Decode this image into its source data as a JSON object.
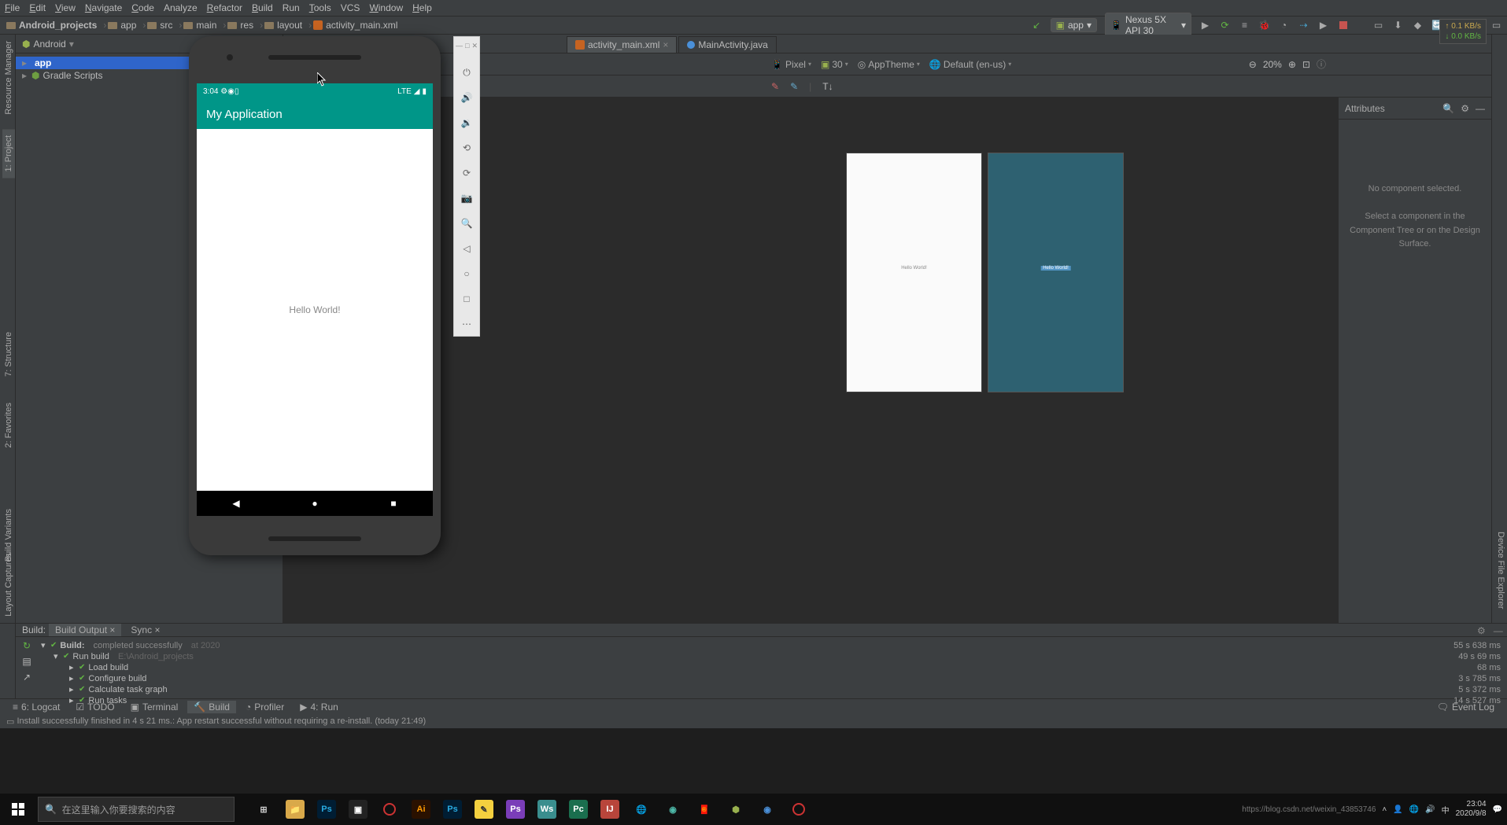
{
  "menu": {
    "file": "File",
    "edit": "Edit",
    "view": "View",
    "navigate": "Navigate",
    "code": "Code",
    "analyze": "Analyze",
    "refactor": "Refactor",
    "build": "Build",
    "run": "Run",
    "tools": "Tools",
    "vcs": "VCS",
    "window": "Window",
    "help": "Help"
  },
  "breadcrumb": {
    "root": "Android_projects",
    "app": "app",
    "src": "src",
    "main": "main",
    "res": "res",
    "layout": "layout",
    "file": "activity_main.xml"
  },
  "run_config": {
    "module": "app",
    "device": "Nexus 5X API 30"
  },
  "net": {
    "up": "↑ 0.1 KB/s",
    "down": "↓ 0.0 KB/s"
  },
  "project": {
    "view": "Android",
    "root": "app",
    "gradle": "Gradle Scripts"
  },
  "tabs": {
    "t1": "activity_main.xml",
    "t2": "MainActivity.java"
  },
  "design": {
    "device": "Pixel",
    "api": "30",
    "theme": "AppTheme",
    "locale": "Default (en-us)",
    "zoom": "20%",
    "attr_title": "Attributes",
    "attr_msg1": "No component selected.",
    "attr_msg2": "Select a component in the Component Tree or on the Design Surface."
  },
  "preview": {
    "text": "Hello World!"
  },
  "emulator": {
    "time": "3:04",
    "lte": "LTE",
    "app_title": "My Application",
    "content": "Hello World!"
  },
  "build": {
    "tab_build": "Build:",
    "tab_output": "Build Output",
    "tab_sync": "Sync",
    "root": "Build:",
    "root_status": "completed successfully",
    "root_at": "at 2020",
    "run": "Run build",
    "run_path": "E:\\Android_projects",
    "load": "Load build",
    "configure": "Configure build",
    "taskgraph": "Calculate task graph",
    "runtasks": "Run tasks",
    "times": {
      "t1": "55 s 638 ms",
      "t2": "49 s 69 ms",
      "t3": "68 ms",
      "t4": "3 s 785 ms",
      "t5": "5 s 372 ms",
      "t6": "14 s 527 ms"
    }
  },
  "bottom": {
    "logcat": "6: Logcat",
    "todo": "TODO",
    "terminal": "Terminal",
    "build": "Build",
    "profiler": "Profiler",
    "run": "4: Run",
    "eventlog": "Event Log"
  },
  "status": {
    "msg": "Install successfully finished in 4 s 21 ms.: App restart successful without requiring a re-install. (today 21:49)"
  },
  "taskbar": {
    "search_placeholder": "在这里输入你要搜索的内容",
    "url": "https://blog.csdn.net/weixin_43853746",
    "time": "23:04",
    "date": "2020/9/8"
  },
  "left_tabs": {
    "rm": "Resource Manager",
    "proj": "1: Project",
    "struct": "7: Structure",
    "fav": "2: Favorites",
    "bv": "Build Variants",
    "lc": "Layout Captures"
  },
  "right_tabs": {
    "dfe": "Device File Explorer"
  }
}
